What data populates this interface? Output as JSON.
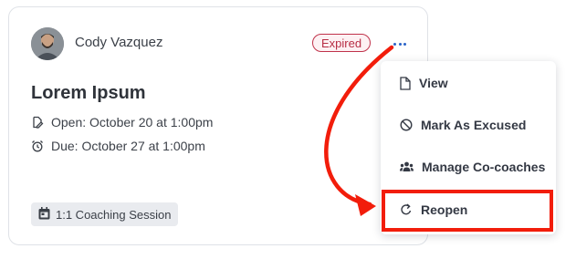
{
  "card": {
    "user_name": "Cody Vazquez",
    "status": "Expired",
    "title": "Lorem Ipsum",
    "open_text": "Open: October 20 at 1:00pm",
    "due_text": "Due: October 27 at 1:00pm",
    "session_tag": "1:1 Coaching Session"
  },
  "menu": {
    "items": [
      {
        "label": "View",
        "icon": "document-icon"
      },
      {
        "label": "Mark As Excused",
        "icon": "block-icon"
      },
      {
        "label": "Manage Co-coaches",
        "icon": "group-icon"
      },
      {
        "label": "Reopen",
        "icon": "reopen-arrow-icon"
      }
    ]
  },
  "colors": {
    "expired_badge": "#c0324a",
    "more_dots": "#2a63c9",
    "annotation_red": "#f21d0b"
  }
}
